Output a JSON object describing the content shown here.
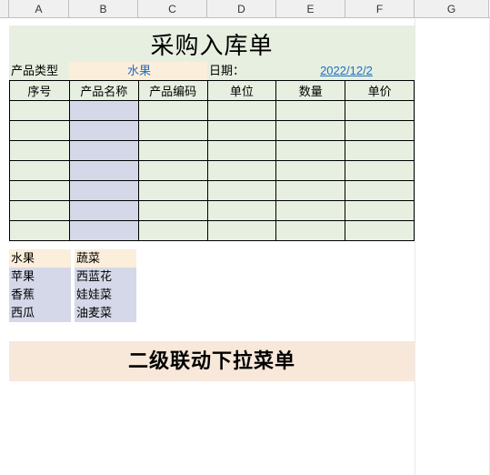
{
  "columns": [
    "A",
    "B",
    "C",
    "D",
    "E",
    "F",
    "G"
  ],
  "title": "采购入库单",
  "info": {
    "type_label": "产品类型",
    "type_value": "水果",
    "date_label": "日期：",
    "date_value": "2022/12/2"
  },
  "table": {
    "headers": [
      "序号",
      "产品名称",
      "产品编码",
      "单位",
      "数量",
      "单价"
    ],
    "rows": [
      [
        "",
        "",
        "",
        "",
        "",
        ""
      ],
      [
        "",
        "",
        "",
        "",
        "",
        ""
      ],
      [
        "",
        "",
        "",
        "",
        "",
        ""
      ],
      [
        "",
        "",
        "",
        "",
        "",
        ""
      ],
      [
        "",
        "",
        "",
        "",
        "",
        ""
      ],
      [
        "",
        "",
        "",
        "",
        "",
        ""
      ],
      [
        "",
        "",
        "",
        "",
        "",
        ""
      ]
    ]
  },
  "lookup": {
    "headers": [
      "水果",
      "蔬菜"
    ],
    "rows": [
      [
        "苹果",
        "西蓝花"
      ],
      [
        "香蕉",
        "娃娃菜"
      ],
      [
        "西瓜",
        "油麦菜"
      ]
    ]
  },
  "banner": "二级联动下拉菜单",
  "chart_data": {
    "type": "table",
    "title": "采购入库单",
    "meta": {
      "产品类型": "水果",
      "日期": "2022/12/2"
    },
    "columns": [
      "序号",
      "产品名称",
      "产品编码",
      "单位",
      "数量",
      "单价"
    ],
    "rows": []
  }
}
